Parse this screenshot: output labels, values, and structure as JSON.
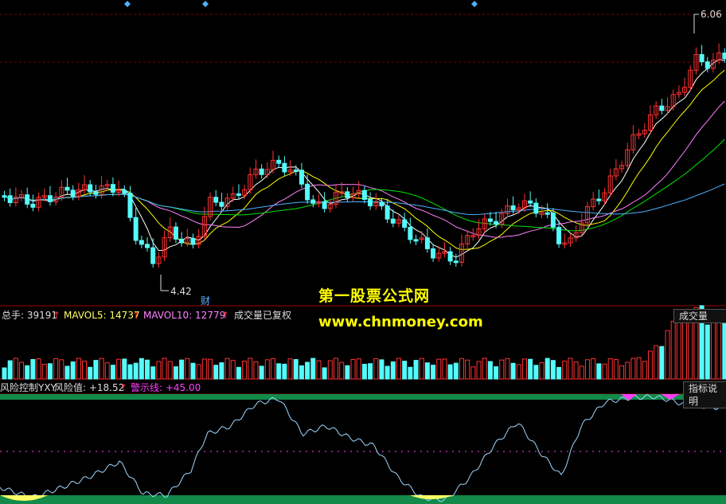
{
  "price_panel": {
    "high_marker": "6.06",
    "low_marker": "4.42",
    "event_tag": "财",
    "colors": {
      "up": "#ff3232",
      "down": "#54fcfc",
      "ma5": "#ffffff",
      "ma10": "#ffff00",
      "ma20": "#ff80ff",
      "ma30": "#00e600",
      "ma60": "#4fb0ff"
    }
  },
  "volume_panel": {
    "total_label": "总手: 39191",
    "mavol5_label": "MAVOL5: 14737",
    "mavol10_label": "MAVOL10: 12779",
    "note": "成交量已复权",
    "selector": "成交量"
  },
  "risk_panel": {
    "title": "风险控制YXY",
    "value_label": "风险值: +18.52",
    "warn_label": "警示线: +45.00",
    "help_button": "指标说明"
  },
  "watermark": {
    "line1": "第一股票公式网",
    "line2": "www.chnmoney.com"
  }
}
